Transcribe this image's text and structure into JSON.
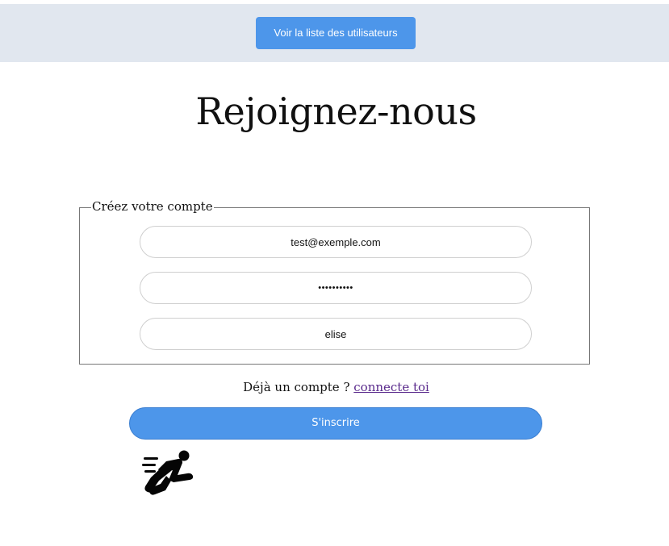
{
  "header": {
    "users_button_label": "Voir la liste des utilisateurs"
  },
  "page": {
    "title": "Rejoignez-nous"
  },
  "form": {
    "legend": "Créez votre compte",
    "email_value": "test@exemple.com",
    "password_value": "••••••••••",
    "username_value": "elise",
    "account_prompt": "Déjà un compte ?",
    "login_link_label": "connecte toi",
    "submit_label": "S'inscrire"
  },
  "icons": {
    "runner": "running-person-icon"
  },
  "colors": {
    "header_background": "#e1e7ef",
    "primary_button": "#4d96ea",
    "link": "#5a2a8c"
  }
}
